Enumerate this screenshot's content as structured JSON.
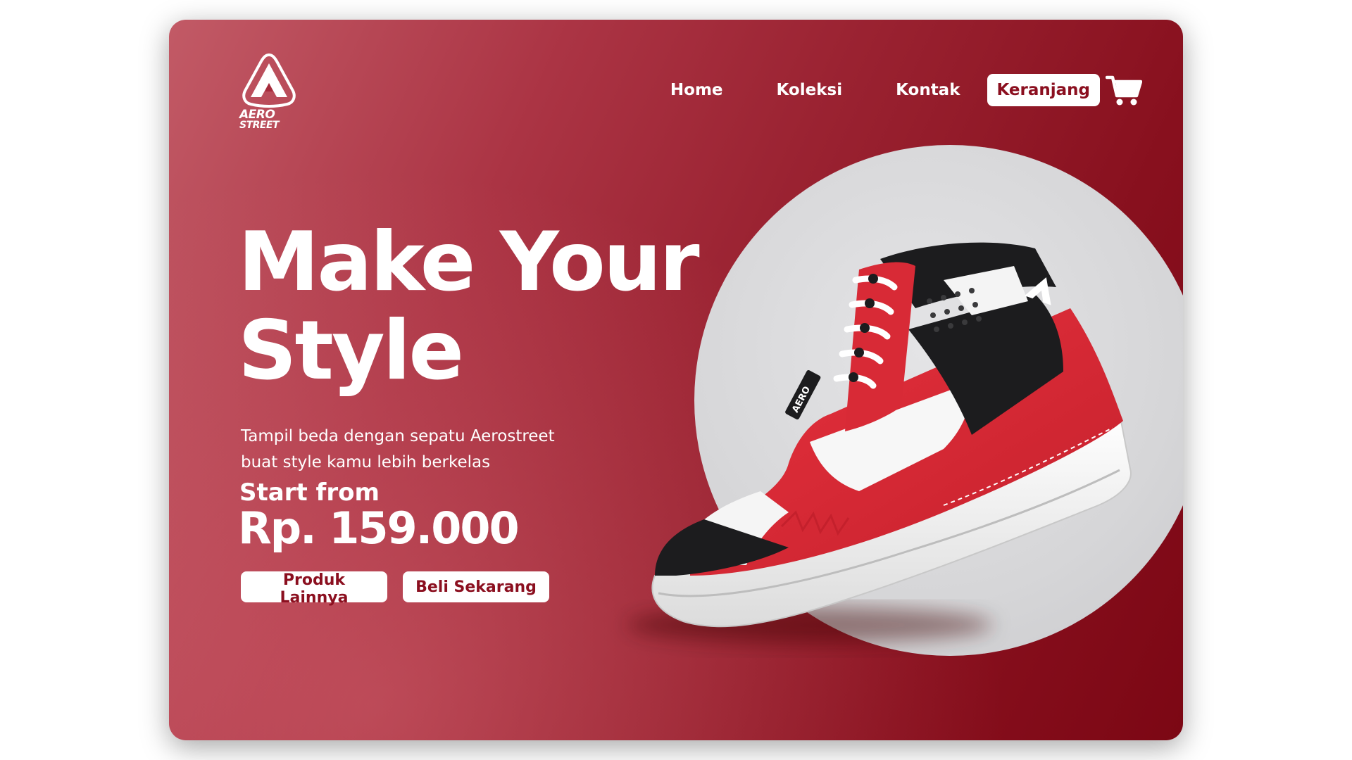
{
  "brand": {
    "logo_line1": "AERO",
    "logo_line2": "STREET"
  },
  "nav": {
    "items": [
      {
        "label": "Home"
      },
      {
        "label": "Koleksi"
      },
      {
        "label": "Kontak"
      }
    ],
    "cart_label": "Keranjang"
  },
  "hero": {
    "headline_line1": "Make Your",
    "headline_line2": "Style",
    "subtext": "Tampil beda dengan sepatu Aerostreet buat style kamu lebih berkelas",
    "start_label": "Start from",
    "price": "Rp. 159.000",
    "secondary_button": "Produk Lainnya",
    "primary_button": "Beli Sekarang",
    "shoe_tag": "AERO"
  },
  "colors": {
    "brand_red": "#8b0f1f",
    "gradient_light": "#c25a66",
    "gradient_dark": "#7c0714",
    "circle_gray": "#d6d6d8"
  },
  "icons": {
    "logo": "aerostreet-a-logo-icon",
    "cart": "shopping-cart-icon"
  }
}
